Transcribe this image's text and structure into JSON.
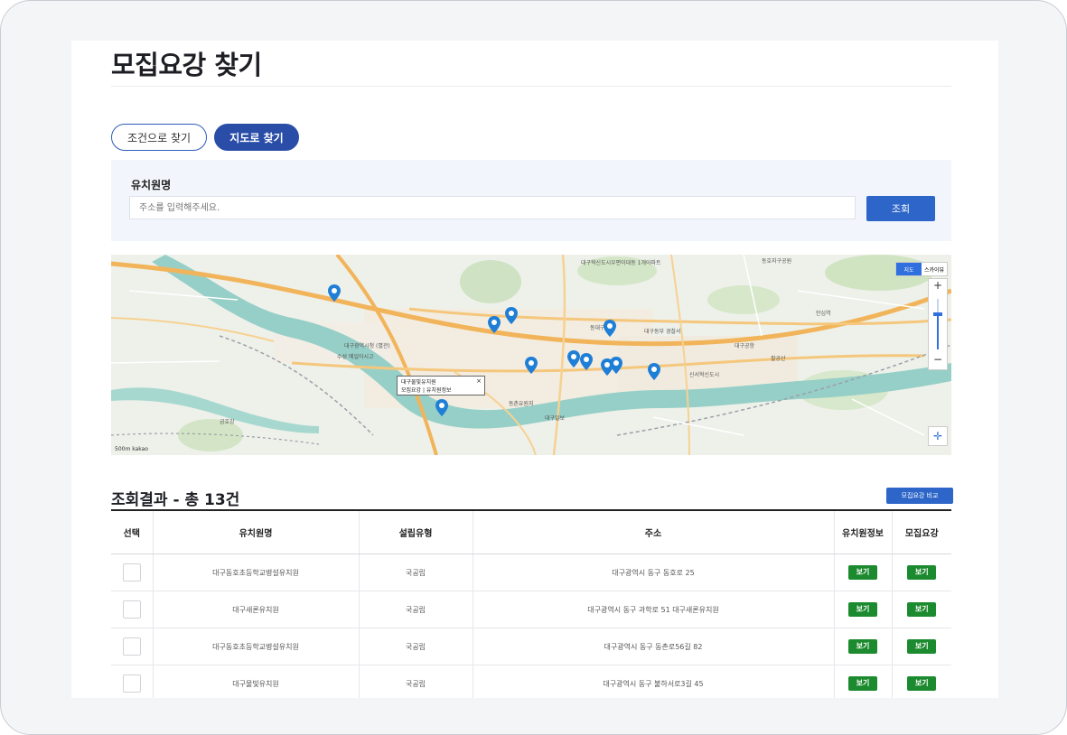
{
  "page": {
    "title": "모집요강 찾기"
  },
  "tabs": {
    "condition_label": "조건으로 찾기",
    "map_label": "지도로 찾기"
  },
  "search": {
    "label": "유치원명",
    "placeholder": "주소를 입력해주세요.",
    "button_label": "조회"
  },
  "map": {
    "toggle_map": "지도",
    "toggle_sky": "스카이뷰",
    "zoom_in": "+",
    "zoom_out": "−",
    "scale_text": "500m kakao",
    "popup_title": "대구물빛유치원",
    "popup_links": "모집요강 | 유치원정보",
    "popup_close": "×",
    "place_labels": [
      "대구혁신도시우편이대동 1개아파트",
      "동호지구공원",
      "동대구역",
      "대구동부 경찰서",
      "대구공항",
      "안심역",
      "대구광역시청 (별관)",
      "신서혁신도시",
      "수성 메일아시고",
      "대구일보",
      "금호강",
      "동촌유원지",
      "팔공산"
    ],
    "pin_count": 13
  },
  "results": {
    "title": "조회결과 - 총 13건",
    "compare_button": "모집요강 비교"
  },
  "table": {
    "headers": [
      "선택",
      "유치원명",
      "설립유형",
      "주소",
      "유치원정보",
      "모집요강"
    ],
    "view_label": "보기",
    "rows": [
      {
        "name": "대구동호초등학교병설유치원",
        "type": "국공립",
        "address": "대구광역시 동구 동호로 25"
      },
      {
        "name": "대구새론유치원",
        "type": "국공립",
        "address": "대구광역시 동구 과학로 51 대구새론유치원"
      },
      {
        "name": "대구동호초등학교병설유치원",
        "type": "국공립",
        "address": "대구광역시 동구 동촌로56길 82"
      },
      {
        "name": "대구물빛유치원",
        "type": "국공립",
        "address": "대구광역시 동구 불하서로3길 45"
      }
    ]
  },
  "colors": {
    "primary": "#2a4ea8",
    "button_blue": "#2d65c8",
    "view_green": "#1c8a2e",
    "search_bg": "#f2f6fc"
  }
}
